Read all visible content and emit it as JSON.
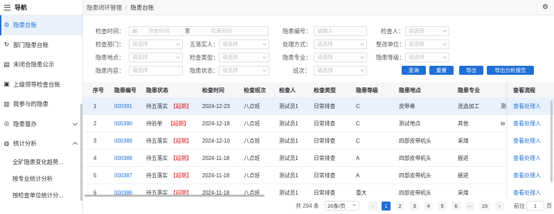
{
  "sidebar": {
    "title": "导航",
    "items": [
      {
        "label": "隐患台账"
      },
      {
        "label": "部门隐患台账"
      },
      {
        "label": "未闭合隐患公示"
      },
      {
        "label": "上级领导检查台账"
      },
      {
        "label": "我参与的隐患"
      },
      {
        "label": "隐患督办"
      },
      {
        "label": "统计分析"
      }
    ],
    "subitems": [
      {
        "label": "全矿隐患变化趋势..."
      },
      {
        "label": "按专业统计分析"
      },
      {
        "label": "按检查单位统计分..."
      }
    ]
  },
  "header": {
    "breadcrumb_parent": "隐患闭环管理",
    "breadcrumb_sep": "/",
    "breadcrumb_current": "隐患台账"
  },
  "form": {
    "check_time_label": "检查时间：",
    "start_placeholder": "开始时间",
    "range_sep": "至",
    "end_placeholder": "结束时间",
    "hazard_no_label": "隐患编号：",
    "hazard_no_placeholder": "请输入",
    "inspector_label": "检查人：",
    "inspector_placeholder": "请选择",
    "check_dept_label": "检查部门：",
    "check_dept_placeholder": "请选择",
    "five_impl_label": "五落实人：",
    "five_impl_placeholder": "请选择",
    "handling_label": "处理方式：",
    "handling_placeholder": "请选择",
    "rectify_unit_label": "整改单位：",
    "rectify_unit_placeholder": "请选择",
    "location_label": "隐患地点：",
    "location_placeholder": "请选择",
    "check_type_label": "检查类型：",
    "check_type_placeholder": "请选择",
    "major_label": "隐患专业：",
    "major_placeholder": "请选择",
    "level_label": "隐患等级：",
    "level_placeholder": "请选择",
    "content_label": "隐患内容：",
    "content_placeholder": "请选择",
    "status_label": "隐患状态：",
    "status_placeholder": "请选择",
    "shift_label": "班次：",
    "shift_placeholder": "请选择",
    "buttons": {
      "query": "查询",
      "reset": "重置",
      "export": "导出",
      "export_report": "导出分析报告"
    }
  },
  "table": {
    "columns": [
      "序号",
      "隐患编号",
      "隐患状态",
      "检查时间",
      "检查班次",
      "检查人",
      "检查类型",
      "隐患等级",
      "隐患地点",
      "隐患专业",
      "查看流程"
    ],
    "rows": [
      {
        "no": "1",
        "code": "000391",
        "status": "待五落实",
        "tag": "【超期】",
        "time": "2024-12-23",
        "shift": "八点班",
        "inspector": "测试员1",
        "type": "日常排查",
        "level": "C",
        "location": "皮带巷",
        "major": "洗选加工",
        "extra": "测",
        "action": "查看处理人"
      },
      {
        "no": "2",
        "code": "000390",
        "status": "待验单",
        "tag": "【超期】",
        "time": "2024-12-18",
        "shift": "八点班",
        "inspector": "测试员1",
        "type": "日常排查",
        "level": "C",
        "location": "测试地点",
        "major": "其他",
        "extra": "te",
        "action": "查看处理人"
      },
      {
        "no": "3",
        "code": "000389",
        "status": "待五落实",
        "tag": "【超期】",
        "time": "2024-12-10",
        "shift": "八点班",
        "inspector": "测试员1",
        "type": "日常排查",
        "level": "C",
        "location": "四部皮带机头",
        "major": "采煤",
        "extra": "",
        "action": "查看处理人"
      },
      {
        "no": "4",
        "code": "000388",
        "status": "待五落实",
        "tag": "【超期】",
        "time": "2024-11-18",
        "shift": "八点班",
        "inspector": "测试员1",
        "type": "日常排查",
        "level": "A",
        "location": "四部皮带机头",
        "major": "掘进",
        "extra": "",
        "action": "查看处理人"
      },
      {
        "no": "5",
        "code": "000387",
        "status": "待五落实",
        "tag": "【超期】",
        "time": "2024-11-18",
        "shift": "八点班",
        "inspector": "测试员1",
        "type": "日常排查",
        "level": "A",
        "location": "四部皮带机头",
        "major": "掘进",
        "extra": "",
        "action": "查看处理人"
      },
      {
        "no": "6",
        "code": "000386",
        "status": "待五落实",
        "tag": "【超期】",
        "time": "2024-11-18",
        "shift": "八点班",
        "inspector": "测试员1",
        "type": "日常排查",
        "level": "重大",
        "location": "四部皮带机头",
        "major": "采煤",
        "extra": "",
        "action": "查看处理人"
      }
    ]
  },
  "pager": {
    "total": "共 294 条",
    "page_size": "20条/页",
    "pages": [
      "1",
      "2",
      "3",
      "4",
      "5",
      "6",
      "···",
      "15"
    ],
    "current": "1",
    "goto_label": "前往",
    "goto_value": "1",
    "goto_unit": "页"
  },
  "colors": {
    "accent": "#1f6fd6",
    "warning": "#e02020"
  },
  "icons": [
    "menu-icon",
    "gear-icon",
    "settings-icon",
    "document-icon",
    "bell-icon",
    "person-up-icon",
    "chart-icon",
    "shield-icon",
    "stats-icon",
    "chevron-down-icon",
    "chevron-up-icon",
    "chevron-left-icon",
    "chevron-right-icon"
  ]
}
